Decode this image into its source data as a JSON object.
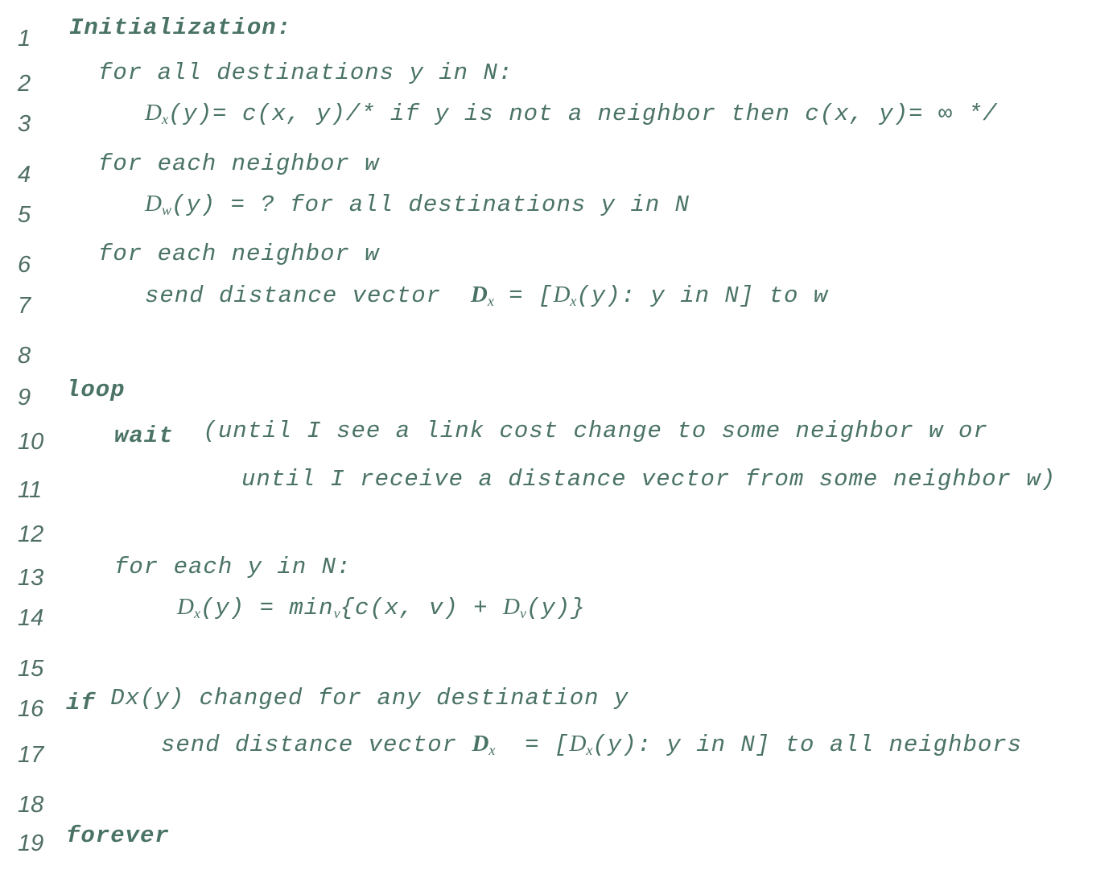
{
  "line_numbers": [
    "1",
    "2",
    "3",
    "4",
    "5",
    "6",
    "7",
    "8",
    "9",
    "10",
    "11",
    "12",
    "13",
    "14",
    "15",
    "16",
    "17",
    "18",
    "19"
  ],
  "code": {
    "l1": "Initialization:",
    "l2": "for all destinations y in N:",
    "l3": {
      "D": "D",
      "sub": "x",
      "rest": "(y)= c(x, y)/* if y is not a neighbor then c(x, y)= ∞ */"
    },
    "l4": "for each neighbor w",
    "l5": {
      "D": "D",
      "sub": "w",
      "rest": "(y) = ? for all destinations y in N"
    },
    "l6": "for each neighbor w",
    "l7": {
      "pre": "send distance vector ",
      "Dbold": "D",
      "subbold": "x",
      "mid": " = [",
      "D": "D",
      "sub": "x",
      "rest": "(y): y in N] to w"
    },
    "l9": "loop",
    "l10": {
      "kw": "wait",
      "rest": " (until I see a link cost change to some neighbor w or"
    },
    "l11": "until I receive a distance vector from some neighbor w)",
    "l13": "for each y in N:",
    "l14": {
      "D": "D",
      "sub": "x",
      "mid": "(y) = min",
      "sub2": "v",
      "mid2": "{c(x, v) + ",
      "D2": "D",
      "sub3": "v",
      "rest": "(y)}"
    },
    "l16": {
      "kw": "if",
      "rest": " Dx(y) changed for any destination y"
    },
    "l17": {
      "pre": "send distance vector ",
      "Dbold": "D",
      "subbold": "x",
      "mid": "  = [",
      "D": "D",
      "sub": "x",
      "rest": "(y): y in N] to all neighbors"
    },
    "l19": "forever"
  },
  "colors": {
    "text": "#4a7366",
    "line_number": "#4f6e66",
    "background": "#ffffff"
  }
}
